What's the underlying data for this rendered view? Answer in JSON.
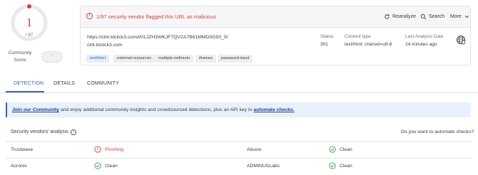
{
  "score": {
    "value": "1",
    "total": "/ 97",
    "ratio": 0.0103,
    "community_label": "Community Score",
    "community_value": "-"
  },
  "alert": {
    "text": "1/97 security vendor flagged this URL as malicious",
    "color": "#d23f3f"
  },
  "actions": {
    "reanalyze": "Reanalyze",
    "search": "Search",
    "more": "More"
  },
  "url": {
    "line1": "https://ctrk.klclick3.com/l/01JZH3WKJF7QV2A7B61MMD0G50_0/",
    "line2": "ctrk.klclick3.com"
  },
  "tags": [
    "text/html",
    "external-resources",
    "multiple-redirects",
    "iframes",
    "password-input"
  ],
  "meta": {
    "status_label": "Status",
    "status_value": "301",
    "content_label": "Content type",
    "content_value": "text/html; charset=utf-8",
    "last_label": "Last Analysis Date",
    "last_value": "24 minutes ago"
  },
  "tabs": [
    "DETECTION",
    "DETAILS",
    "COMMUNITY"
  ],
  "banner": {
    "link1": "Join our Community",
    "mid": " and enjoy additional community insights and crowdsourced detections, plus an API key to ",
    "link2": "automate checks."
  },
  "analysis": {
    "title": "Security vendors' analysis",
    "automate_q": "Do you want to automate checks?"
  },
  "vendors": [
    {
      "name": "Trustwave",
      "result": "Phishing",
      "bad": true
    },
    {
      "name": "Abusix",
      "result": "Clean",
      "bad": false
    },
    {
      "name": "Acronis",
      "result": "Clean",
      "bad": false
    },
    {
      "name": "ADMINUSLabs",
      "result": "Clean",
      "bad": false
    }
  ],
  "colors": {
    "accent": "#3a62b5",
    "malicious": "#d23f3f",
    "clean": "#3f9d4a"
  }
}
